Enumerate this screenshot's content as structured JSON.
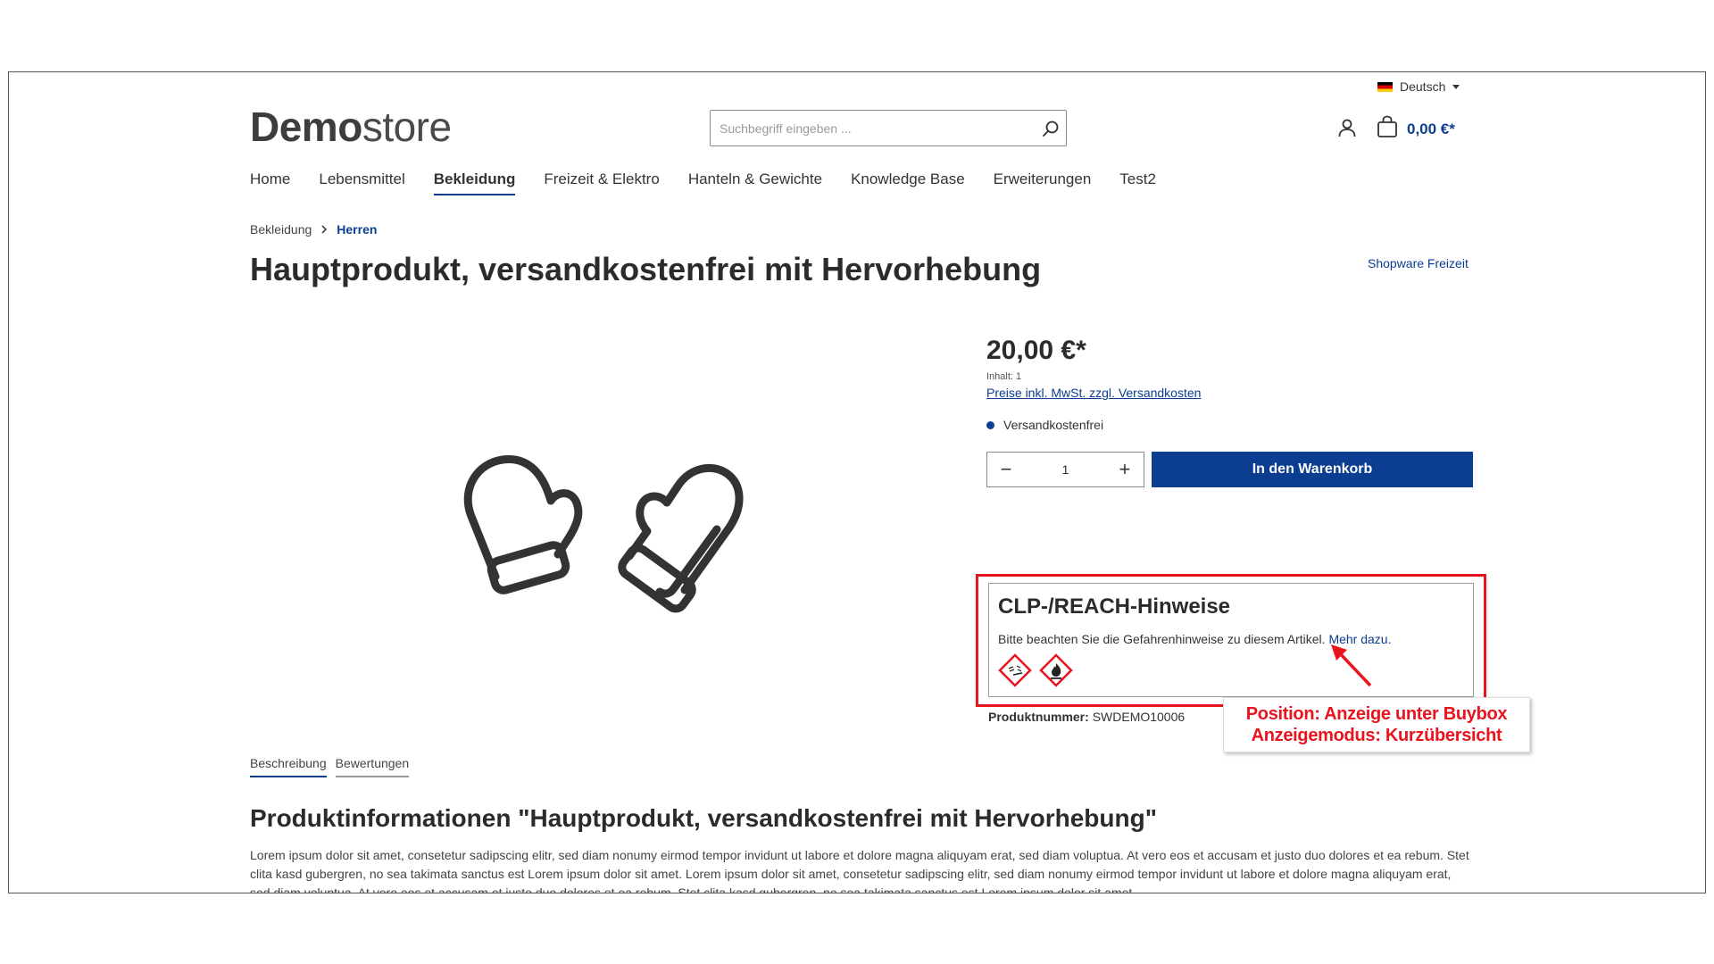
{
  "header": {
    "language": "Deutsch",
    "logo_bold": "Demo",
    "logo_thin": "store",
    "search_placeholder": "Suchbegriff eingeben ...",
    "cart_total": "0,00 €*"
  },
  "nav": {
    "items": [
      {
        "label": "Home",
        "active": false
      },
      {
        "label": "Lebensmittel",
        "active": false
      },
      {
        "label": "Bekleidung",
        "active": true
      },
      {
        "label": "Freizeit & Elektro",
        "active": false
      },
      {
        "label": "Hanteln & Gewichte",
        "active": false
      },
      {
        "label": "Knowledge Base",
        "active": false
      },
      {
        "label": "Erweiterungen",
        "active": false
      },
      {
        "label": "Test2",
        "active": false
      }
    ]
  },
  "breadcrumb": {
    "parent": "Bekleidung",
    "current": "Herren"
  },
  "product": {
    "title": "Hauptprodukt, versandkostenfrei mit Hervorhebung",
    "manufacturer": "Shopware Freizeit",
    "price": "20,00 €*",
    "content": "Inhalt: 1",
    "tax_link": "Preise inkl. MwSt. zzgl. Versandkosten",
    "delivery": "Versandkostenfrei",
    "quantity": "1",
    "add_to_cart": "In den Warenkorb",
    "product_number_label": "Produktnummer:",
    "product_number": "SWDEMO10006"
  },
  "clp": {
    "heading": "CLP-/REACH-Hinweise",
    "text": "Bitte beachten Sie die Gefahrenhinweise zu diesem Artikel.",
    "link": "Mehr dazu.",
    "pictograms": [
      "corrosive-icon",
      "flammable-icon"
    ]
  },
  "annotation": {
    "line1": "Position: Anzeige unter Buybox",
    "line2": "Anzeigemodus: Kurzübersicht"
  },
  "tabs": {
    "description": "Beschreibung",
    "reviews": "Bewertungen"
  },
  "description": {
    "title": "Produktinformationen \"Hauptprodukt, versandkostenfrei mit Hervorhebung\"",
    "text": "Lorem ipsum dolor sit amet, consetetur sadipscing elitr, sed diam nonumy eirmod tempor invidunt ut labore et dolore magna aliquyam erat, sed diam voluptua. At vero eos et accusam et justo duo dolores et ea rebum. Stet clita kasd gubergren, no sea takimata sanctus est Lorem ipsum dolor sit amet. Lorem ipsum dolor sit amet, consetetur sadipscing elitr, sed diam nonumy eirmod tempor invidunt ut labore et dolore magna aliquyam erat, sed diam voluptua. At vero eos et accusam et justo duo dolores et ea rebum. Stet clita kasd gubergren, no sea takimata sanctus est Lorem ipsum dolor sit amet."
  },
  "colors": {
    "accent": "#0b3d91",
    "annotation_red": "#e8141e"
  }
}
